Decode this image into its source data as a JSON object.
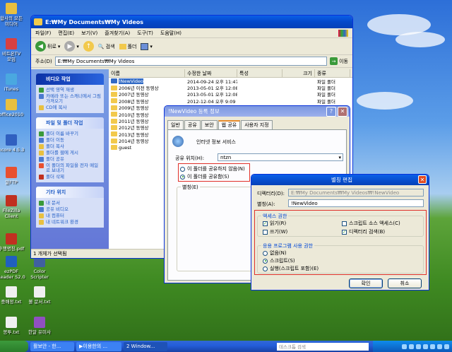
{
  "desktop_icons": [
    {
      "label": "합사의 모든",
      "color": "#e8c040",
      "sub": "미디어"
    },
    {
      "label": "비트온TV",
      "color": "#d84040",
      "sub": "모임"
    },
    {
      "label": "iTunes",
      "color": "#4aa8e0",
      "sub": ""
    },
    {
      "label": "office2010",
      "color": "#e8c040",
      "sub": ""
    },
    {
      "label": "ncore 4.5.3",
      "color": "#3060c0",
      "sub": ""
    },
    {
      "label": "알FTP",
      "color": "#e85030",
      "sub": ""
    },
    {
      "label": "FileZilla",
      "color": "#c03020",
      "sub": "Client"
    },
    {
      "label": "후행명칭.pdf",
      "color": "#c03020",
      "sub": ""
    },
    {
      "label": "ezPDF",
      "color": "#2060c0",
      "sub": "Reader S2.0"
    },
    {
      "label": "Color",
      "color": "#4060a0",
      "sub": "Scripter"
    },
    {
      "label": "중배정.txt",
      "color": "#f0f0f0",
      "sub": ""
    },
    {
      "label": "볼 문서.txt",
      "color": "#f0f0f0",
      "sub": ""
    },
    {
      "label": "봉투.txt",
      "color": "#f0f0f0",
      "sub": ""
    },
    {
      "label": "한알 유미사",
      "color": "#9050c0",
      "sub": ""
    }
  ],
  "explorer": {
    "title": "E:₩My Documents₩My Videos",
    "menu": [
      "파일(F)",
      "편집(E)",
      "보기(V)",
      "즐겨찾기(A)",
      "도구(T)",
      "도움말(H)"
    ],
    "toolbar": {
      "back": "뒤로",
      "search": "검색",
      "folders": "폴더"
    },
    "address_label": "주소(D)",
    "address": "E:₩My Documents₩My Videos",
    "go": "이동",
    "panels": [
      {
        "title": "비디오 작업",
        "items": [
          "선택 영역 재생",
          "카메라 또는 스캐너에서 그림 가져오기",
          "CD에 복사"
        ]
      },
      {
        "title": "파일 및 폴더 작업",
        "items": [
          "폴더 이름 바꾸기",
          "폴더 이동",
          "폴더 복사",
          "폴더를 웹에 게시",
          "폴더 공유",
          "이 폴더의 파일을 전자 메일로 보내기",
          "폴더 삭제"
        ]
      },
      {
        "title": "기타 위치",
        "items": [
          "내 문서",
          "공유 비디오",
          "내 컴퓨터",
          "내 네트워크 환경"
        ]
      }
    ],
    "columns": [
      "이름",
      "수정한 날짜",
      "특성",
      "크기",
      "종류"
    ],
    "files": [
      {
        "name": "!NewVideo",
        "date": "2014-09-24 오후 11:47",
        "type": "파일 폴더"
      },
      {
        "name": "2006년 이전 동영상",
        "date": "2013-05-01 오후 12:08",
        "type": "파일 폴더"
      },
      {
        "name": "2007년 동영상",
        "date": "2013-05-01 오후 12:08",
        "type": "파일 폴더"
      },
      {
        "name": "2008년 동영상",
        "date": "2012-12-04 오후 9:09",
        "type": "파일 폴더"
      },
      {
        "name": "2009년 동영상",
        "date": "2012-12-04 오후 9:09",
        "type": "파일 폴더"
      },
      {
        "name": "2010년 동영상",
        "date": "",
        "type": ""
      },
      {
        "name": "2011년 동영상",
        "date": "",
        "type": ""
      },
      {
        "name": "2012년 동영상",
        "date": "",
        "type": ""
      },
      {
        "name": "2013년 동영상",
        "date": "",
        "type": ""
      },
      {
        "name": "2014년 동영상",
        "date": "",
        "type": ""
      },
      {
        "name": "guest",
        "date": "",
        "type": ""
      }
    ],
    "status": "1 개체가 선택됨"
  },
  "props": {
    "title": "!NewVideo 등록 정보",
    "tabs": [
      "일반",
      "공유",
      "보안",
      "웹 공유",
      "사용자 지정"
    ],
    "service": "인터넷 정보 서비스",
    "share_on_label": "공유 위치(H):",
    "share_on_value": "ntzn",
    "radio_no": "이 폴더를 공유하지 않음(N)",
    "radio_yes": "이 폴더를 공유함(S)",
    "alias_label": "별칭(E)"
  },
  "alias": {
    "title": "별칭 편집",
    "dir_label": "디렉터리(D):",
    "dir_value": "E:₩My Documents₩My Videos₩!NewVideo",
    "alias_label": "별칭(A):",
    "alias_value": "!NewVideo",
    "access_group": "액세스 권한",
    "read": "읽기(R)",
    "write": "쓰기(W)",
    "script_source": "스크립트 소스 액세스(C)",
    "dir_browse": "디렉터리 검색(B)",
    "app_group": "응용 프로그램 사용 권한",
    "none": "없음(N)",
    "scripts": "스크립트(S)",
    "execute": "실행(스크립트 포함)(E)",
    "ok": "확인",
    "cancel": "취소"
  },
  "taskbar": {
    "items": [
      "활보안 - 한...",
      "▶이용한의 ...",
      "2 Window..."
    ],
    "search_placeholder": "데스크톱 검색",
    "tray_icons": 7
  }
}
